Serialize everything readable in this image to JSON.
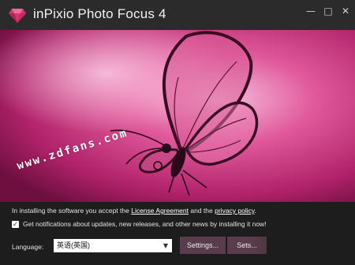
{
  "window": {
    "title": "inPixio Photo Focus 4",
    "minimize_glyph": "—",
    "maximize_glyph": "□",
    "close_glyph": "✕"
  },
  "hero": {
    "image": "pink-butterfly-photo",
    "watermark": "www.zdfans.com"
  },
  "footer": {
    "license_prefix": "In installing the software you accept the",
    "license_link": "License Agreement",
    "and_text": "and the",
    "privacy_link": "privacy policy",
    "period": ".",
    "notifications_text": "Get notifications about updates, new releases, and other news by installing it now!",
    "notifications_checked": true,
    "checkbox_glyph": "✓",
    "language_label": "Language:",
    "language_value": "英语(英国)",
    "settings_button": "Settings...",
    "install_button": "Sets..."
  },
  "colors": {
    "accent": "#d0457d",
    "button": "#5a3d4c",
    "background": "#1d1d1d"
  }
}
